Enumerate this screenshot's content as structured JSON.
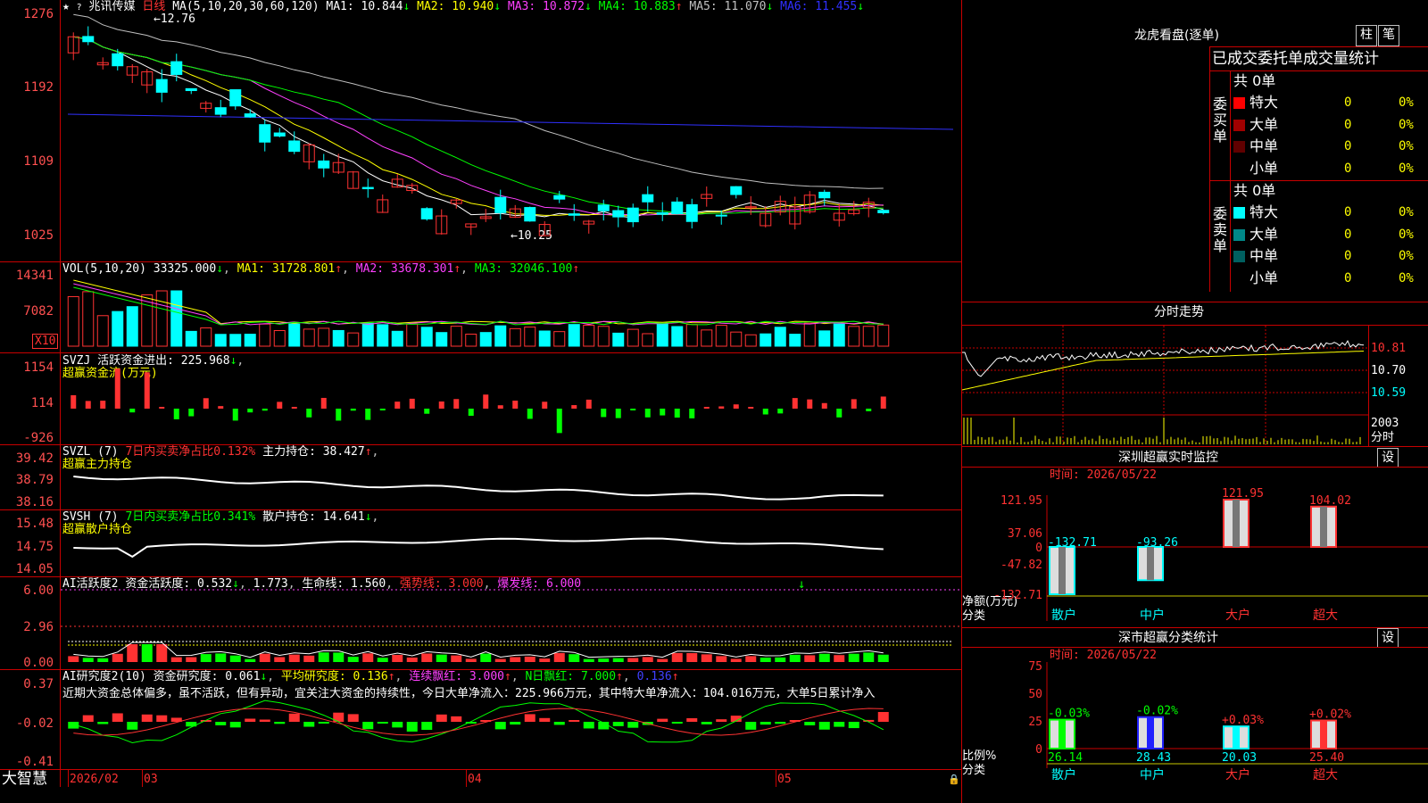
{
  "app": {
    "brand": "大智慧"
  },
  "kline": {
    "stock_name": "兆讯传媒",
    "period": "日线",
    "ma_header": "MA(5,10,20,30,60,120)",
    "ma": [
      {
        "label": "MA1: 10.844",
        "arrow": "↓",
        "color": "#ffffff"
      },
      {
        "label": "MA2: 10.940",
        "arrow": "↓",
        "color": "#ffff00"
      },
      {
        "label": "MA3: 10.872",
        "arrow": "↓",
        "color": "#ff40ff"
      },
      {
        "label": "MA4: 10.883",
        "arrow": "↑",
        "color": "#00ff00"
      },
      {
        "label": "MA5: 11.070",
        "arrow": "↓",
        "color": "#c0c0c0"
      },
      {
        "label": "MA6: 11.455",
        "arrow": "↓",
        "color": "#3030ff"
      }
    ],
    "y_ticks": [
      "1276",
      "1192",
      "1109",
      "1025"
    ],
    "high_label": "12.76",
    "low_label": "10.25",
    "x_labels": [
      "2026/02",
      "03",
      "04",
      "05"
    ]
  },
  "vol": {
    "header": "VOL(5,10,20)",
    "value": "33325.000",
    "value_arrow": "↓",
    "ma1": "MA1: 31728.801",
    "ma1_arrow": "↑",
    "ma2": "MA2: 33678.301",
    "ma2_arrow": "↑",
    "ma3": "MA3: 32046.100",
    "ma3_arrow": "↑",
    "y_ticks": [
      "14341",
      "7082"
    ],
    "unit": "X10"
  },
  "svzj": {
    "header": "SVZJ",
    "text": "活跃资金进出: 225.968",
    "arrow": "↓",
    "subtitle": "超赢资金流(万元)",
    "y_ticks": [
      "1154",
      "114",
      "-926"
    ]
  },
  "svzl": {
    "header": "SVZL (7)",
    "ratio": "7日内买卖净占比0.132%",
    "hold": "主力持仓: 38.427",
    "arrow": "↑",
    "subtitle": "超赢主力持仓",
    "y_ticks": [
      "39.42",
      "38.79",
      "38.16"
    ]
  },
  "svsh": {
    "header": "SVSH (7)",
    "ratio": "7日内买卖净占比0.341%",
    "hold": "散户持仓: 14.641",
    "arrow": "↓",
    "subtitle": "超赢散户持仓",
    "y_ticks": [
      "15.48",
      "14.75",
      "14.05"
    ]
  },
  "ai_active": {
    "header": "AI活跃度2",
    "l1": "资金活跃度: 0.532",
    "l1_arrow": "↓",
    "l2": "1.773",
    "l3": "生命线: 1.560",
    "l4": "强势线: 3.000",
    "l5": "爆发线: 6.000",
    "y_ticks": [
      "6.00",
      "2.96",
      "0.00"
    ]
  },
  "ai_research": {
    "header": "AI研究度2(10)",
    "l1": "资金研究度: 0.061",
    "l1_arrow": "↓",
    "l2": "平均研究度: 0.136",
    "l2_arrow": "↑",
    "l3": "连续飘红: 3.000",
    "l3_arrow": "↑",
    "l4": "N日飘红: 7.000",
    "l4_arrow": "↑",
    "l5": "0.136",
    "l5_arrow": "↑",
    "comment": "近期大资金总体偏多，虽不活跃，但有异动，宜关注大资金的持续性，今日大单净流入：225.966万元，其中特大单净流入：104.016万元，大单5日累计净入",
    "y_ticks": [
      "0.37",
      "-0.02",
      "-0.41"
    ]
  },
  "dragon": {
    "title": "龙虎看盘(逐单)",
    "btn1": "柱",
    "btn2": "笔",
    "subtitle": "已成交委托单成交量统计",
    "buy_group": "委买单",
    "sell_group": "委卖单",
    "buy_total": "共 0单",
    "sell_total": "共 0单",
    "buy_rows": [
      {
        "name": "特大",
        "count": "0",
        "pct": "0%",
        "color": "#ff0000"
      },
      {
        "name": "大单",
        "count": "0",
        "pct": "0%",
        "color": "#a00000"
      },
      {
        "name": "中单",
        "count": "0",
        "pct": "0%",
        "color": "#600000"
      },
      {
        "name": "小单",
        "count": "0",
        "pct": "0%",
        "color": ""
      }
    ],
    "sell_rows": [
      {
        "name": "特大",
        "count": "0",
        "pct": "0%",
        "color": "#00ffff"
      },
      {
        "name": "大单",
        "count": "0",
        "pct": "0%",
        "color": "#008888"
      },
      {
        "name": "中单",
        "count": "0",
        "pct": "0%",
        "color": "#006060"
      },
      {
        "name": "小单",
        "count": "0",
        "pct": "0%",
        "color": ""
      }
    ]
  },
  "intraday": {
    "title": "分时走势",
    "price_ticks": [
      "10.81",
      "10.70",
      "10.59"
    ],
    "vol_tick": "2003",
    "vol_label": "分时"
  },
  "sz_monitor": {
    "title": "深圳超赢实时监控",
    "set_btn": "设",
    "time": "时间: 2026/05/22",
    "y_ticks": [
      "121.95",
      "37.06",
      "0",
      "-47.82",
      "-132.71"
    ],
    "ylabel1": "净额(万元)",
    "ylabel2": "分类",
    "bars": [
      {
        "cat": "散户",
        "value": -132.71,
        "label": "-132.71",
        "color": "#00ffff"
      },
      {
        "cat": "中户",
        "value": -93.26,
        "label": "-93.26",
        "color": "#00ffff"
      },
      {
        "cat": "大户",
        "value": 121.95,
        "label": "121.95",
        "color": "#ff3232"
      },
      {
        "cat": "超大",
        "value": 104.02,
        "label": "104.02",
        "color": "#ff3232"
      }
    ],
    "ylim": [
      -132.71,
      121.95
    ]
  },
  "sz_class": {
    "title": "深市超赢分类统计",
    "set_btn": "设",
    "time": "时间: 2026/05/22",
    "y_ticks": [
      "75",
      "50",
      "25",
      "0"
    ],
    "ylabel1": "比例%",
    "ylabel2": "分类",
    "bars": [
      {
        "cat": "散户",
        "value": 26.14,
        "label": "26.14",
        "delta": "-0.03%",
        "fill": "#00ff00",
        "delta_color": "#00ff00",
        "val_color": "#00ff00"
      },
      {
        "cat": "中户",
        "value": 28.43,
        "label": "28.43",
        "delta": "-0.02%",
        "fill": "#2020ff",
        "delta_color": "#00ff00",
        "val_color": "#00ffff"
      },
      {
        "cat": "大户",
        "value": 20.03,
        "label": "20.03",
        "delta": "+0.03%",
        "fill": "#00ffff",
        "delta_color": "#ff3232",
        "val_color": "#00ffff"
      },
      {
        "cat": "超大",
        "value": 25.4,
        "label": "25.40",
        "delta": "+0.02%",
        "fill": "#ff3232",
        "delta_color": "#ff3232",
        "val_color": "#ff3232"
      }
    ],
    "ylim": [
      0,
      75
    ]
  }
}
